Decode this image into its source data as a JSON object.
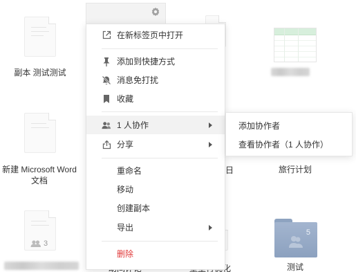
{
  "files": [
    {
      "name": "副本 测试测试"
    },
    {
      "name": ""
    },
    {
      "name": "新建 Microsoft Word 文档"
    },
    {
      "name": "旅行计划"
    },
    {
      "name": "",
      "collaborators": "3"
    },
    {
      "name": "测试",
      "collaborators": "5"
    }
  ],
  "partial_labels": {
    "behind_menu_right": "日",
    "behind_bottom_1": "助间评论",
    "behind_bottom_2": "壁垒行优化"
  },
  "menu": {
    "items": [
      {
        "label": "在新标签页中打开",
        "icon": "open-new-tab-icon"
      },
      {
        "label": "添加到快捷方式",
        "icon": "pin-icon"
      },
      {
        "label": "消息免打扰",
        "icon": "mute-bell-icon"
      },
      {
        "label": "收藏",
        "icon": "bookmark-icon"
      },
      {
        "label": "1 人协作",
        "icon": "people-icon",
        "submenu": true
      },
      {
        "label": "分享",
        "icon": "share-icon",
        "submenu": true
      },
      {
        "label": "重命名"
      },
      {
        "label": "移动"
      },
      {
        "label": "创建副本"
      },
      {
        "label": "导出",
        "submenu": true
      },
      {
        "label": "删除",
        "danger": true
      }
    ]
  },
  "submenu": {
    "items": [
      {
        "label": "添加协作者"
      },
      {
        "label": "查看协作者（1 人协作）"
      }
    ]
  },
  "colors": {
    "danger": "#e03b3b",
    "hover": "#f2f2f2",
    "folder": "#9aaecb",
    "sheet_header": "#d7efdc"
  }
}
